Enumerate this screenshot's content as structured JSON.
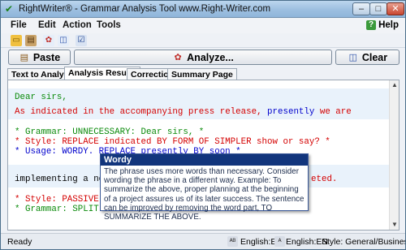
{
  "window": {
    "title": "RightWriter® - Grammar Analysis Tool www.Right-Writer.com"
  },
  "window_buttons": {
    "minimize": "–",
    "maximize": "□",
    "close": "✕"
  },
  "menu": [
    "File",
    "Edit",
    "Action",
    "Tools"
  ],
  "help": "Help",
  "actions": {
    "paste": "Paste",
    "analyze": "Analyze...",
    "clear": "Clear"
  },
  "tabs": [
    "Text to Analyze",
    "Analysis Results",
    "Correction",
    "Summary Page"
  ],
  "active_tab": "Analysis Results",
  "content": {
    "line1": "Dear sirs,",
    "line2": {
      "a": "As ",
      "b": "indicated",
      "c": " in the accompanying press release, ",
      "d": "presently",
      "e": " we are"
    },
    "line3": "* Grammar: UNNECESSARY: Dear sirs, *",
    "line4": "* Style: REPLACE indicated BY FORM OF SIMPLER show or say? *",
    "line5": "* Usage: WORDY. REPLACE presently BY soon *",
    "line6a": "implementing a new",
    "line6b": "eted.",
    "line7": "* Style: PASSIVE VO",
    "line8": "* Grammar: SPLIT IN"
  },
  "tooltip": {
    "title": "Wordy",
    "body": "The phrase uses more words than necessary. Consider wording the phrase in a different way. Example: To summarize the above, proper planning at the beginning of a project assures us of its later success. The sentence can be improved by removing the word part, TO SUMMARIZE THE ABOVE."
  },
  "status": {
    "ready": "Ready",
    "lang1": "English:EN",
    "lang2": "English:EN",
    "style": "Style:  General/Business"
  }
}
